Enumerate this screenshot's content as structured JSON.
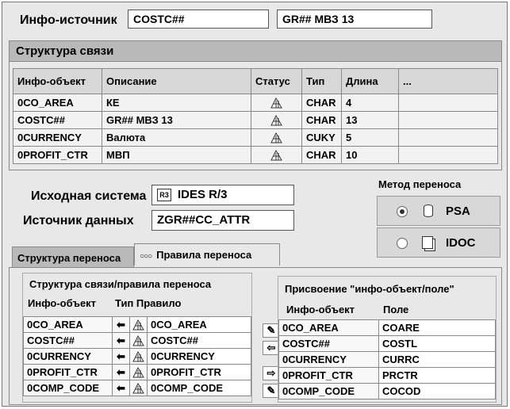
{
  "header": {
    "source_label": "Инфо-источник",
    "source_code": "COSTC##",
    "source_name": "GR## МВЗ 13"
  },
  "structure": {
    "title": "Структура связи",
    "columns": [
      "Инфо-объект",
      "Описание",
      "Статус",
      "Тип",
      "Длина",
      "..."
    ],
    "rows": [
      {
        "obj": "0CO_AREA",
        "desc": "КЕ",
        "type": "CHAR",
        "len": "4"
      },
      {
        "obj": "COSTC##",
        "desc": "GR## МВЗ 13",
        "type": "CHAR",
        "len": "13"
      },
      {
        "obj": "0CURRENCY",
        "desc": "Валюта",
        "type": "CUKY",
        "len": "5"
      },
      {
        "obj": "0PROFIT_CTR",
        "desc": "МВП",
        "type": "CHAR",
        "len": "10"
      }
    ]
  },
  "source_system": {
    "label": "Исходная система",
    "value": "IDES R/3"
  },
  "data_source": {
    "label": "Источник данных",
    "value": "ZGR##CC_ATTR"
  },
  "transfer_method": {
    "title": "Метод переноса",
    "options": [
      {
        "label": "PSA",
        "selected": true,
        "icon": "database-icon"
      },
      {
        "label": "IDOC",
        "selected": false,
        "icon": "document-icon"
      }
    ]
  },
  "tabs": {
    "tab1": "Структура переноса",
    "tab2": "Правила переноса",
    "tab2_icon": "glasses-icon"
  },
  "rules": {
    "title": "Структура связи/правила переноса",
    "col_obj": "Инфо-объект",
    "col_rule": "Тип Правило",
    "rows": [
      {
        "obj": "0CO_AREA",
        "rule": "0CO_AREA"
      },
      {
        "obj": "COSTC##",
        "rule": "COSTC##"
      },
      {
        "obj": "0CURRENCY",
        "rule": "0CURRENCY"
      },
      {
        "obj": "0PROFIT_CTR",
        "rule": "0PROFIT_CTR"
      },
      {
        "obj": "0COMP_CODE",
        "rule": "0COMP_CODE"
      }
    ]
  },
  "assignment": {
    "title": "Присвоение \"инфо-объект/поле\"",
    "col_obj": "Инфо-объект",
    "col_field": "Поле",
    "rows": [
      {
        "obj": "0CO_AREA",
        "field": "COARE"
      },
      {
        "obj": "COSTC##",
        "field": "COSTL"
      },
      {
        "obj": "0CURRENCY",
        "field": "CURRC"
      },
      {
        "obj": "0PROFIT_CTR",
        "field": "PRCTR"
      },
      {
        "obj": "0COMP_CODE",
        "field": "COCOD"
      }
    ]
  },
  "colors": {
    "panel": "#e8e8e8",
    "header_band": "#b9b9b9"
  }
}
